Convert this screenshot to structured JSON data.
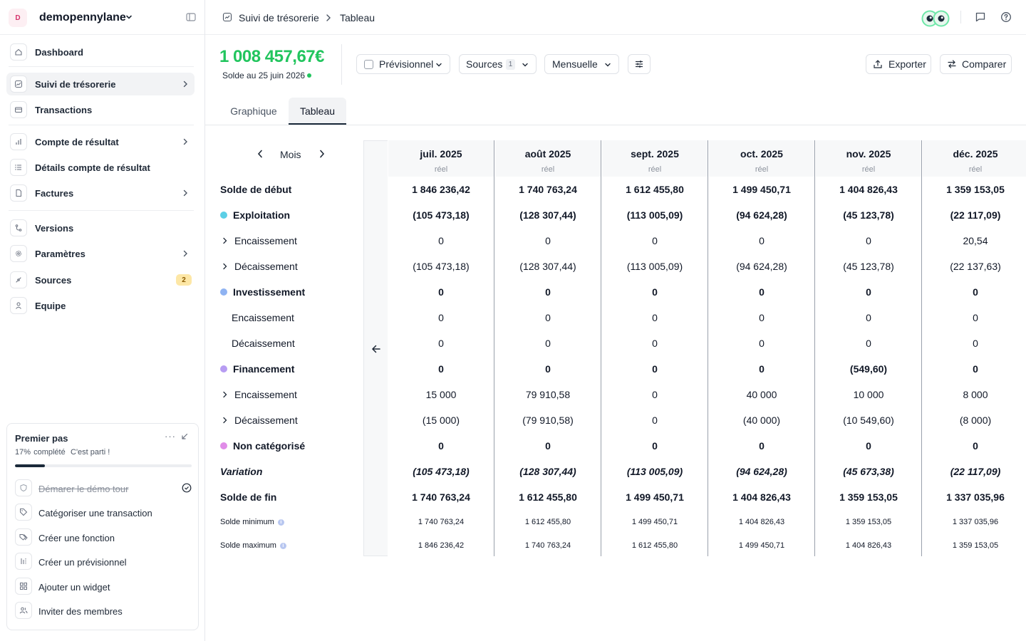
{
  "workspace": {
    "initial": "D",
    "name": "demopennylane"
  },
  "nav": [
    {
      "label": "Dashboard",
      "icon": "home-icon"
    },
    {
      "label": "Suivi de trésorerie",
      "icon": "trend-icon"
    },
    {
      "label": "Transactions",
      "icon": "card-icon"
    },
    {
      "label": "Compte de résultat",
      "icon": "bar-chart-icon"
    },
    {
      "label": "Détails compte de résultat",
      "icon": "list-icon"
    },
    {
      "label": "Factures",
      "icon": "document-icon"
    },
    {
      "label": "Versions",
      "icon": "branch-icon"
    },
    {
      "label": "Paramètres",
      "icon": "gear-icon"
    },
    {
      "label": "Sources",
      "icon": "plug-icon",
      "badge": "2"
    },
    {
      "label": "Equipe",
      "icon": "user-icon"
    }
  ],
  "onboarding": {
    "title": "Premier pas",
    "progress_text": "17% complété",
    "status_text": "C'est parti !",
    "progress": 0.17,
    "tasks": [
      {
        "label": "Démarer le démo tour",
        "done": true
      },
      {
        "label": "Catégoriser une transaction",
        "done": false
      },
      {
        "label": "Créer une fonction",
        "done": false
      },
      {
        "label": "Créer un prévisionnel",
        "done": false
      },
      {
        "label": "Ajouter un widget",
        "done": false
      },
      {
        "label": "Inviter des membres",
        "done": false
      }
    ]
  },
  "breadcrumb": {
    "parent": "Suivi de trésorerie",
    "current": "Tableau"
  },
  "header": {
    "balance": "1 008 457,67€",
    "balance_date": "Solde au 25 juin 2026",
    "forecast_label": "Prévisionnel",
    "sources_label": "Sources",
    "sources_count": "1",
    "period_select": "Mensuelle",
    "export_label": "Exporter",
    "compare_label": "Comparer"
  },
  "tabs": {
    "graph": "Graphique",
    "table": "Tableau"
  },
  "table": {
    "period_unit": "Mois",
    "columns": [
      {
        "month": "juil. 2025",
        "kind": "réel"
      },
      {
        "month": "août 2025",
        "kind": "réel"
      },
      {
        "month": "sept. 2025",
        "kind": "réel"
      },
      {
        "month": "oct. 2025",
        "kind": "réel"
      },
      {
        "month": "nov. 2025",
        "kind": "réel"
      },
      {
        "month": "déc. 2025",
        "kind": "réel"
      }
    ],
    "rows": [
      {
        "label": "Solde de début",
        "style": "bold",
        "values": [
          "1 846 236,42",
          "1 740 763,24",
          "1 612 455,80",
          "1 499 450,71",
          "1 404 826,43",
          "1 359 153,05"
        ]
      },
      {
        "label": "Exploitation",
        "style": "bold",
        "dot": "#5ccfe6",
        "values": [
          "(105 473,18)",
          "(128 307,44)",
          "(113 005,09)",
          "(94 624,28)",
          "(45 123,78)",
          "(22 117,09)"
        ]
      },
      {
        "label": "Encaissement",
        "style": "normal",
        "expand": true,
        "values": [
          "0",
          "0",
          "0",
          "0",
          "0",
          "20,54"
        ]
      },
      {
        "label": "Décaissement",
        "style": "normal",
        "expand": true,
        "values": [
          "(105 473,18)",
          "(128 307,44)",
          "(113 005,09)",
          "(94 624,28)",
          "(45 123,78)",
          "(22 137,63)"
        ]
      },
      {
        "label": "Investissement",
        "style": "bold",
        "dot": "#8fb3f2",
        "values": [
          "0",
          "0",
          "0",
          "0",
          "0",
          "0"
        ]
      },
      {
        "label": "Encaissement",
        "style": "normal",
        "indent": true,
        "values": [
          "0",
          "0",
          "0",
          "0",
          "0",
          "0"
        ]
      },
      {
        "label": "Décaissement",
        "style": "normal",
        "indent": true,
        "values": [
          "0",
          "0",
          "0",
          "0",
          "0",
          "0"
        ]
      },
      {
        "label": "Financement",
        "style": "bold",
        "dot": "#b79cf2",
        "values": [
          "0",
          "0",
          "0",
          "0",
          "(549,60)",
          "0"
        ]
      },
      {
        "label": "Encaissement",
        "style": "normal",
        "expand": true,
        "values": [
          "15 000",
          "79 910,58",
          "0",
          "40 000",
          "10 000",
          "8 000"
        ]
      },
      {
        "label": "Décaissement",
        "style": "normal",
        "expand": true,
        "values": [
          "(15 000)",
          "(79 910,58)",
          "0",
          "(40 000)",
          "(10 549,60)",
          "(8 000)"
        ]
      },
      {
        "label": "Non catégorisé",
        "style": "bold",
        "dot": "#e08ce8",
        "values": [
          "0",
          "0",
          "0",
          "0",
          "0",
          "0"
        ]
      },
      {
        "label": "Variation",
        "style": "italic",
        "values": [
          "(105 473,18)",
          "(128 307,44)",
          "(113 005,09)",
          "(94 624,28)",
          "(45 673,38)",
          "(22 117,09)"
        ]
      },
      {
        "label": "Solde de fin",
        "style": "bold",
        "values": [
          "1 740 763,24",
          "1 612 455,80",
          "1 499 450,71",
          "1 404 826,43",
          "1 359 153,05",
          "1 337 035,96"
        ]
      },
      {
        "label": "Solde minimum",
        "style": "small",
        "info": true,
        "values": [
          "1 740 763,24",
          "1 612 455,80",
          "1 499 450,71",
          "1 404 826,43",
          "1 359 153,05",
          "1 337 035,96"
        ]
      },
      {
        "label": "Solde maximum",
        "style": "small",
        "info": true,
        "values": [
          "1 846 236,42",
          "1 740 763,24",
          "1 612 455,80",
          "1 499 450,71",
          "1 404 826,43",
          "1 359 153,05"
        ]
      }
    ]
  },
  "colors": {
    "accent_green": "#22c55e",
    "primary_dark": "#1b2a3a",
    "badge_yellow": "#fde7a6"
  }
}
